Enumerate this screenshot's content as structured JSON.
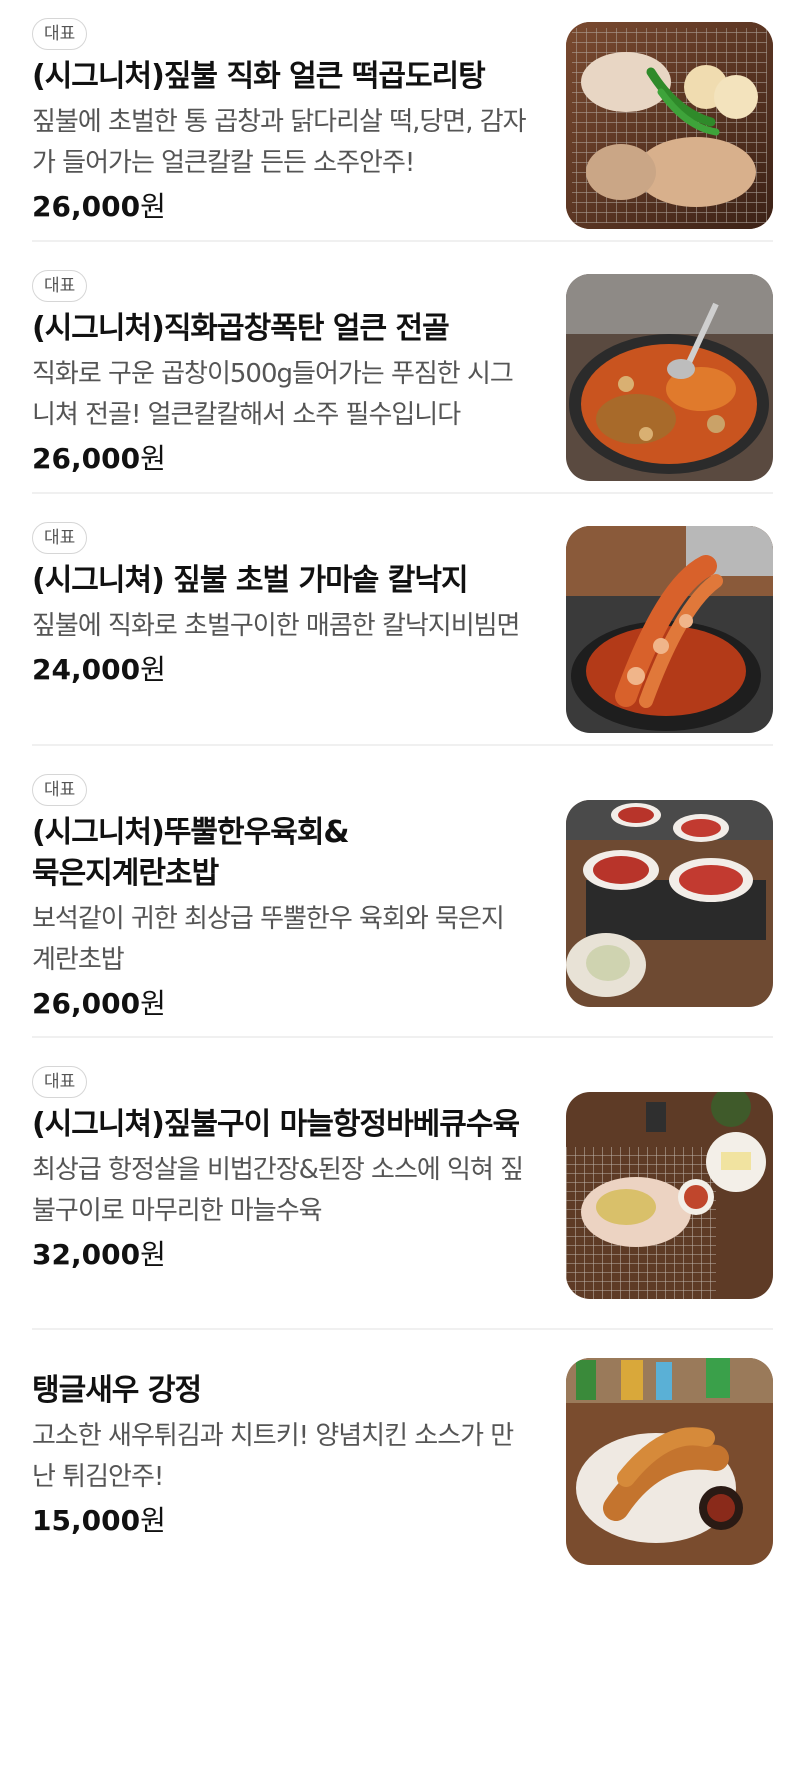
{
  "badge_label": "대표",
  "currency_unit": "원",
  "items": [
    {
      "badge": "대표",
      "title": "(시그니처)짚불 직화 얼큰 떡곱도리탕",
      "description": "짚불에 초벌한 통 곱창과 닭다리살 떡,당면, 감자 가 들어가는 얼큰칼칼 든든 소주안주!",
      "price": "26,000",
      "image_icon": "dish-photo-grilled-gopchang"
    },
    {
      "badge": "대표",
      "title": "(시그니처)직화곱창폭탄 얼큰 전골",
      "description": "직화로 구운 곱창이500g들어가는 푸짐한 시그니쳐 전골! 얼큰칼칼해서 소주 필수입니다",
      "price": "26,000",
      "image_icon": "dish-photo-hotpot"
    },
    {
      "badge": "대표",
      "title": "(시그니쳐) 짚불 초벌 가마솥 칼낙지",
      "description": "짚불에 직화로 초벌구이한 매콤한 칼낙지비빔면",
      "price": "24,000",
      "image_icon": "dish-photo-octopus-noodles"
    },
    {
      "badge": "대표",
      "title": "(시그니처)뚜뿔한우육회&묵은지계란초밥",
      "description": "보석같이 귀한 최상급 뚜뿔한우 육회와 묵은지 계란초밥",
      "price": "26,000",
      "image_icon": "dish-photo-yukhoe"
    },
    {
      "badge": "대표",
      "title": "(시그니쳐)짚불구이 마늘항정바베큐수육",
      "description": "최상급 항정살을 비법간장&된장 소스에 익혀 짚불구이로 마무리한 마늘수육",
      "price": "32,000",
      "image_icon": "dish-photo-suyuk"
    },
    {
      "badge": "",
      "title": "탱글새우 강정",
      "description": "고소한 새우튀김과 치트키! 양념치킨 소스가 만난 튀김안주!",
      "price": "15,000",
      "image_icon": "dish-photo-shrimp"
    }
  ]
}
